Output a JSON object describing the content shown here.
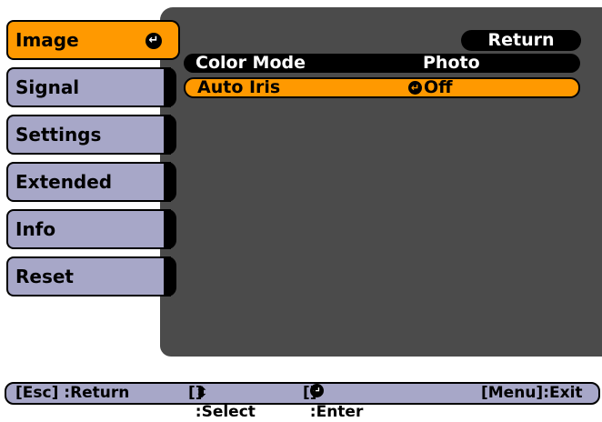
{
  "sidebar": {
    "items": [
      {
        "label": "Image",
        "active": true
      },
      {
        "label": "Signal",
        "active": false
      },
      {
        "label": "Settings",
        "active": false
      },
      {
        "label": "Extended",
        "active": false
      },
      {
        "label": "Info",
        "active": false
      },
      {
        "label": "Reset",
        "active": false
      }
    ]
  },
  "main": {
    "return_label": "Return",
    "rows": [
      {
        "name": "Color Mode",
        "value": "Photo"
      },
      {
        "name": "Auto Iris",
        "value": "Off"
      }
    ]
  },
  "footer": {
    "esc": "[Esc] :Return",
    "select": "] :Select",
    "enter": "] :Enter",
    "exit": "[Menu]:Exit"
  },
  "icons": {
    "enter": "enter-icon",
    "updown": "up-down-arrow-icon"
  },
  "colors": {
    "accent": "#ff9900",
    "inactive_tab": "#a7a7c8",
    "panel": "#4b4b4b"
  }
}
